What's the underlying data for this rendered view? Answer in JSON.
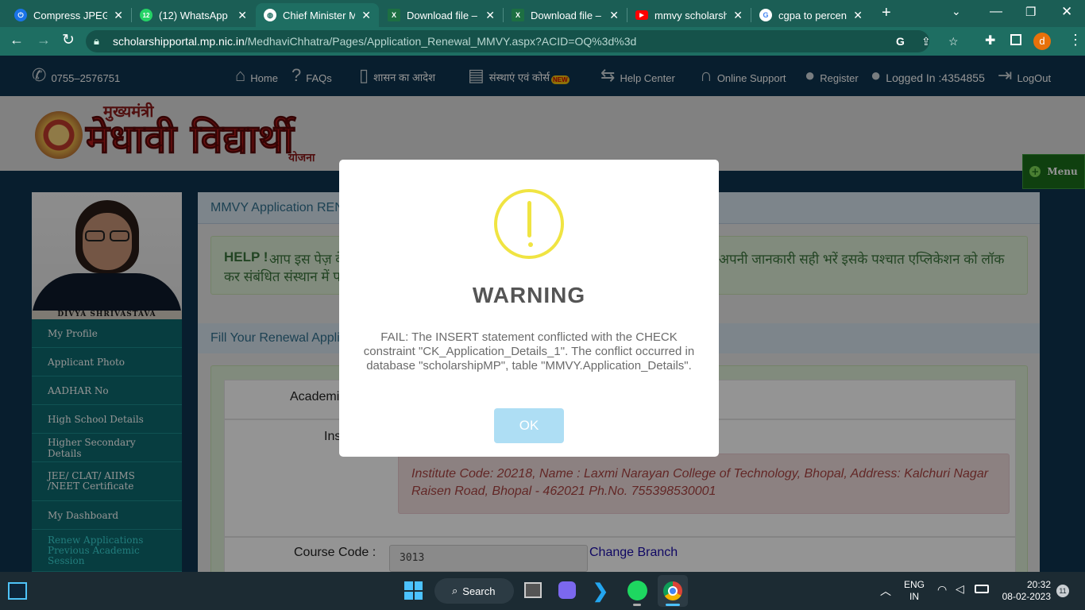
{
  "browser": {
    "tabs": [
      {
        "title": "Compress JPEG To",
        "favicon": "compress-icon",
        "color": "#1a73e8"
      },
      {
        "title": "(12) WhatsApp",
        "favicon": "whatsapp-icon",
        "color": "#25d366"
      },
      {
        "title": "Chief Minister Me",
        "favicon": "globe-icon",
        "color": "#ffffff"
      },
      {
        "title": "Download file – y",
        "favicon": "excel-icon",
        "color": "#1d6f42"
      },
      {
        "title": "Download file – y",
        "favicon": "excel-icon",
        "color": "#1d6f42"
      },
      {
        "title": "mmvy scholarship",
        "favicon": "youtube-icon",
        "color": "#ff0000"
      },
      {
        "title": "cgpa to percenta",
        "favicon": "google-icon",
        "color": "#4285f4"
      }
    ],
    "whatsapp_badge": "12",
    "url_host": "scholarshipportal.mp.nic.in",
    "url_path": "/MedhaviChhatra/Pages/Application_Renewal_MMVY.aspx?ACID=OQ%3d%3d",
    "profile_initial": "d"
  },
  "site": {
    "phone": "0755–2576751",
    "nav": {
      "home": "Home",
      "faqs": "FAQs",
      "govt_order": "शासन का आदेश",
      "institutes": "संस्थाएं एवं कोर्स",
      "new_badge": "NEW",
      "help_center": "Help Center",
      "online_support": "Online Support",
      "register": "Register",
      "logged_in": "Logged In :4354855",
      "logout": "LogOut"
    },
    "logo": {
      "top": "मुख्यमंत्री",
      "main": "मेधावी विद्यार्थी",
      "bottom": "योजना"
    },
    "menu_label": "Menu",
    "student_name": "DIVYA SHRIVASTAVA",
    "sidebar": [
      "My Profile",
      "Applicant Photo",
      "AADHAR No",
      "High School Details",
      "Higher Secondary Details",
      "JEE/ CLAT/ AIIMS /NEET Certificate",
      "My Dashboard",
      "Renew Applications Previous Academic Session"
    ],
    "main": {
      "section_title": "MMVY Application REN",
      "help_label": "HELP !",
      "help_text_left": "आप इस पेज़ के",
      "help_text_left2": "कर संबंधित संस्थान में प",
      "help_text_right": "अपनी जानकारी सही भरें इसके पश्चात एप्लिकेशन को लॉक",
      "fill_title": "Fill Your Renewal Appli",
      "academic_label": "Academi",
      "institute_label": "Ins",
      "institute_info": "Institute Code: 20218, Name : Laxmi Narayan College of Technology, Bhopal, Address: Kalchuri Nagar Raisen Road, Bhopal - 462021 Ph.No. 755398530001",
      "course_code_label": "Course Code :",
      "course_code_value": "3013",
      "change_branch": "Change Branch"
    }
  },
  "modal": {
    "title": "WARNING",
    "message": "FAIL: The INSERT statement conflicted with the CHECK constraint \"CK_Application_Details_1\". The conflict occurred in database \"scholarshipMP\", table \"MMVY.Application_Details\".",
    "ok": "OK",
    "icon": "warning-icon",
    "icon_color": "#f0e442"
  },
  "taskbar": {
    "search": "Search",
    "lang1": "ENG",
    "lang2": "IN",
    "time": "20:32",
    "date": "08-02-2023",
    "notifications": "11"
  }
}
